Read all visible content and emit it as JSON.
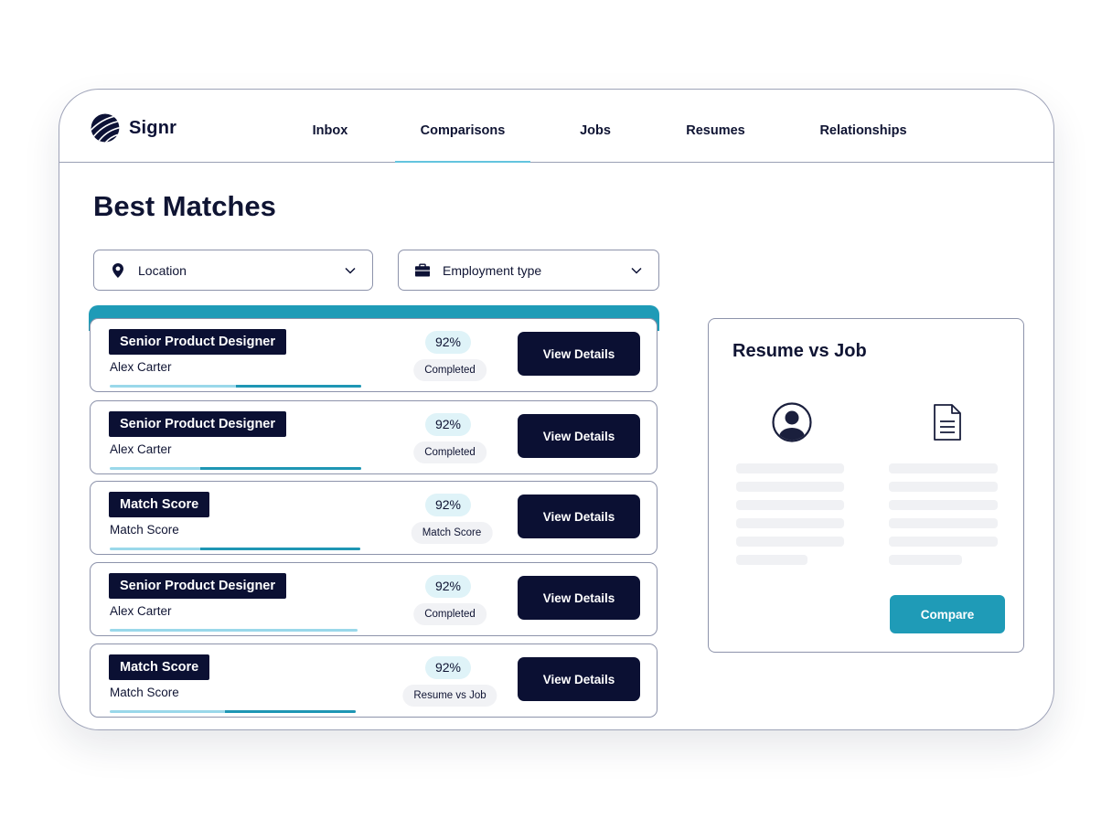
{
  "app": {
    "name": "Signr"
  },
  "nav": {
    "items": [
      {
        "label": "Inbox"
      },
      {
        "label": "Comparisons",
        "active": true
      },
      {
        "label": "Jobs"
      },
      {
        "label": "Resumes"
      },
      {
        "label": "Relationships"
      }
    ]
  },
  "page": {
    "title": "Best Matches"
  },
  "filters": {
    "location": {
      "label": "Location",
      "icon": "location-pin-icon"
    },
    "employment": {
      "label": "Employment type",
      "icon": "briefcase-icon"
    }
  },
  "matches": [
    {
      "tag": "Senior Product Designer",
      "name": "Alex Carter",
      "score": "92%",
      "status": "Completed",
      "progress": 0.5,
      "button": "View Details"
    },
    {
      "tag": "Senior Product Designer",
      "name": "Alex Carter",
      "score": "92%",
      "status": "Completed",
      "progress": 0.64,
      "button": "View Details"
    },
    {
      "tag": "Match Score",
      "name": "Match Score",
      "score": "92%",
      "status": "Match Score",
      "progress": 0.64,
      "button": "View Details"
    },
    {
      "tag": "Senior Product Designer",
      "name": "Alex Carter",
      "score": "92%",
      "status": "Completed",
      "progress": 0.0,
      "button": "View Details"
    },
    {
      "tag": "Match Score",
      "name": "Match Score",
      "score": "92%",
      "status": "Resume vs Job",
      "progress": 0.53,
      "button": "View Details"
    }
  ],
  "panel": {
    "title": "Resume vs Job",
    "left_icon": "user-avatar-icon",
    "right_icon": "document-icon",
    "compare_label": "Compare"
  },
  "colors": {
    "navy": "#0b1033",
    "teal": "#1f9bb7",
    "light_teal": "#9ad8ea",
    "pill_bg": "#dff3f8"
  }
}
